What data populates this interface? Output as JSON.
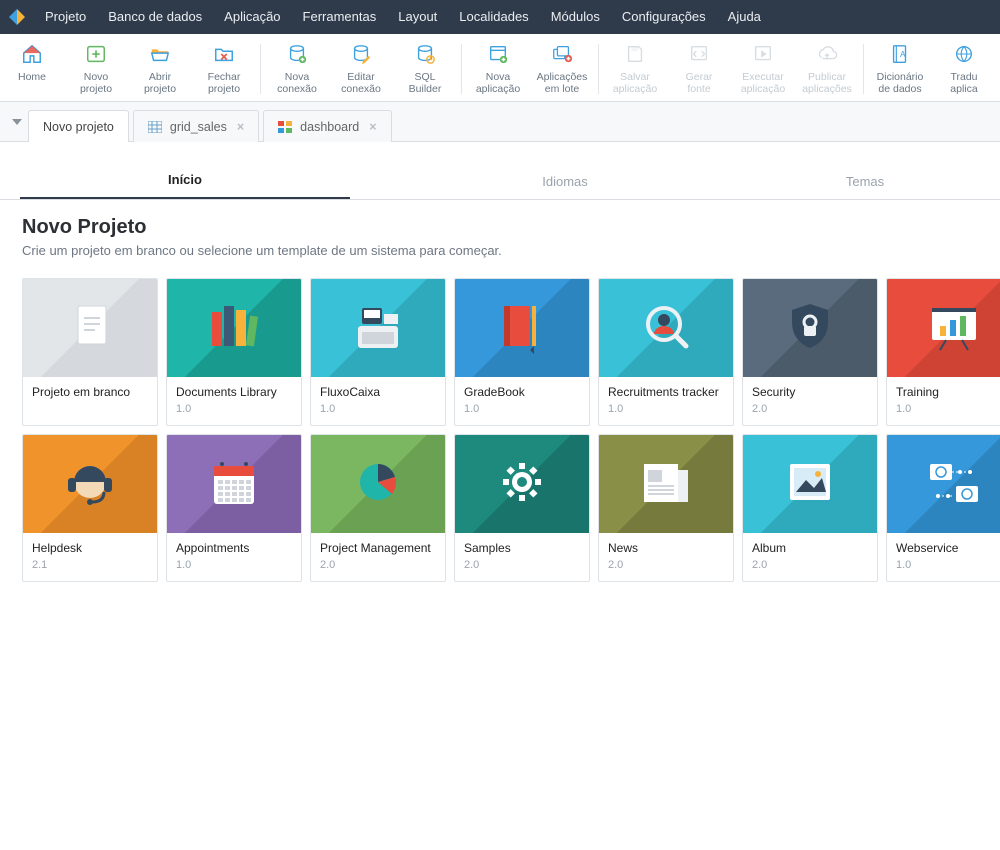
{
  "menubar": {
    "items": [
      "Projeto",
      "Banco de dados",
      "Aplicação",
      "Ferramentas",
      "Layout",
      "Localidades",
      "Módulos",
      "Configurações",
      "Ajuda"
    ]
  },
  "toolbar": {
    "groups": [
      [
        {
          "key": "home",
          "label": "Home",
          "disabled": false
        },
        {
          "key": "novo-projeto",
          "label": "Novo\nprojeto",
          "disabled": false
        },
        {
          "key": "abrir-projeto",
          "label": "Abrir\nprojeto",
          "disabled": false
        },
        {
          "key": "fechar-projeto",
          "label": "Fechar\nprojeto",
          "disabled": false
        }
      ],
      [
        {
          "key": "nova-conexao",
          "label": "Nova\nconexão",
          "disabled": false
        },
        {
          "key": "editar-conexao",
          "label": "Editar\nconexão",
          "disabled": false
        },
        {
          "key": "sql-builder",
          "label": "SQL\nBuilder",
          "disabled": false
        }
      ],
      [
        {
          "key": "nova-aplicacao",
          "label": "Nova\naplicação",
          "disabled": false
        },
        {
          "key": "aplicacoes-em-lote",
          "label": "Aplicações\nem lote",
          "disabled": false
        }
      ],
      [
        {
          "key": "salvar-aplicacao",
          "label": "Salvar\naplicação",
          "disabled": true
        },
        {
          "key": "gerar-fonte",
          "label": "Gerar\nfonte",
          "disabled": true
        },
        {
          "key": "executar-aplicacao",
          "label": "Executar\naplicação",
          "disabled": true
        },
        {
          "key": "publicar-aplicacoes",
          "label": "Publicar\naplicações",
          "disabled": true
        }
      ],
      [
        {
          "key": "dicionario-de-dados",
          "label": "Dicionário\nde dados",
          "disabled": false
        },
        {
          "key": "traduzir-aplicacoes",
          "label": "Tradu\naplica",
          "disabled": false
        }
      ]
    ]
  },
  "tabs": [
    {
      "label": "Novo projeto",
      "closable": false,
      "active": true,
      "icon": "none"
    },
    {
      "label": "grid_sales",
      "closable": true,
      "active": false,
      "icon": "grid"
    },
    {
      "label": "dashboard",
      "closable": true,
      "active": false,
      "icon": "dash"
    }
  ],
  "inner_tabs": [
    {
      "label": "Início",
      "active": true
    },
    {
      "label": "Idiomas",
      "active": false
    },
    {
      "label": "Temas",
      "active": false
    }
  ],
  "section": {
    "title": "Novo Projeto",
    "desc": "Crie um projeto em branco ou selecione um template de um sistema para começar."
  },
  "cards": [
    {
      "title": "Projeto em branco",
      "ver": "",
      "bg": "bg-gray",
      "icon": "blank"
    },
    {
      "title": "Documents Library",
      "ver": "1.0",
      "bg": "bg-teal",
      "icon": "books"
    },
    {
      "title": "FluxoCaixa",
      "ver": "1.0",
      "bg": "bg-cyan",
      "icon": "register"
    },
    {
      "title": "GradeBook",
      "ver": "1.0",
      "bg": "bg-blue",
      "icon": "notebook"
    },
    {
      "title": "Recruitments tracker",
      "ver": "1.0",
      "bg": "bg-cyan",
      "icon": "magnify-user"
    },
    {
      "title": "Security",
      "ver": "2.0",
      "bg": "bg-slate",
      "icon": "shield"
    },
    {
      "title": "Training",
      "ver": "1.0",
      "bg": "bg-red",
      "icon": "presentation"
    },
    {
      "title": "Helpdesk",
      "ver": "2.1",
      "bg": "bg-orange",
      "icon": "headset"
    },
    {
      "title": "Appointments",
      "ver": "1.0",
      "bg": "bg-purple",
      "icon": "calendar"
    },
    {
      "title": "Project Management",
      "ver": "2.0",
      "bg": "bg-green",
      "icon": "pie"
    },
    {
      "title": "Samples",
      "ver": "2.0",
      "bg": "bg-deepteal",
      "icon": "gear"
    },
    {
      "title": "News",
      "ver": "2.0",
      "bg": "bg-olive",
      "icon": "news"
    },
    {
      "title": "Album",
      "ver": "2.0",
      "bg": "bg-cyan",
      "icon": "picture"
    },
    {
      "title": "Webservice",
      "ver": "1.0",
      "bg": "bg-blue",
      "icon": "webservice"
    }
  ]
}
